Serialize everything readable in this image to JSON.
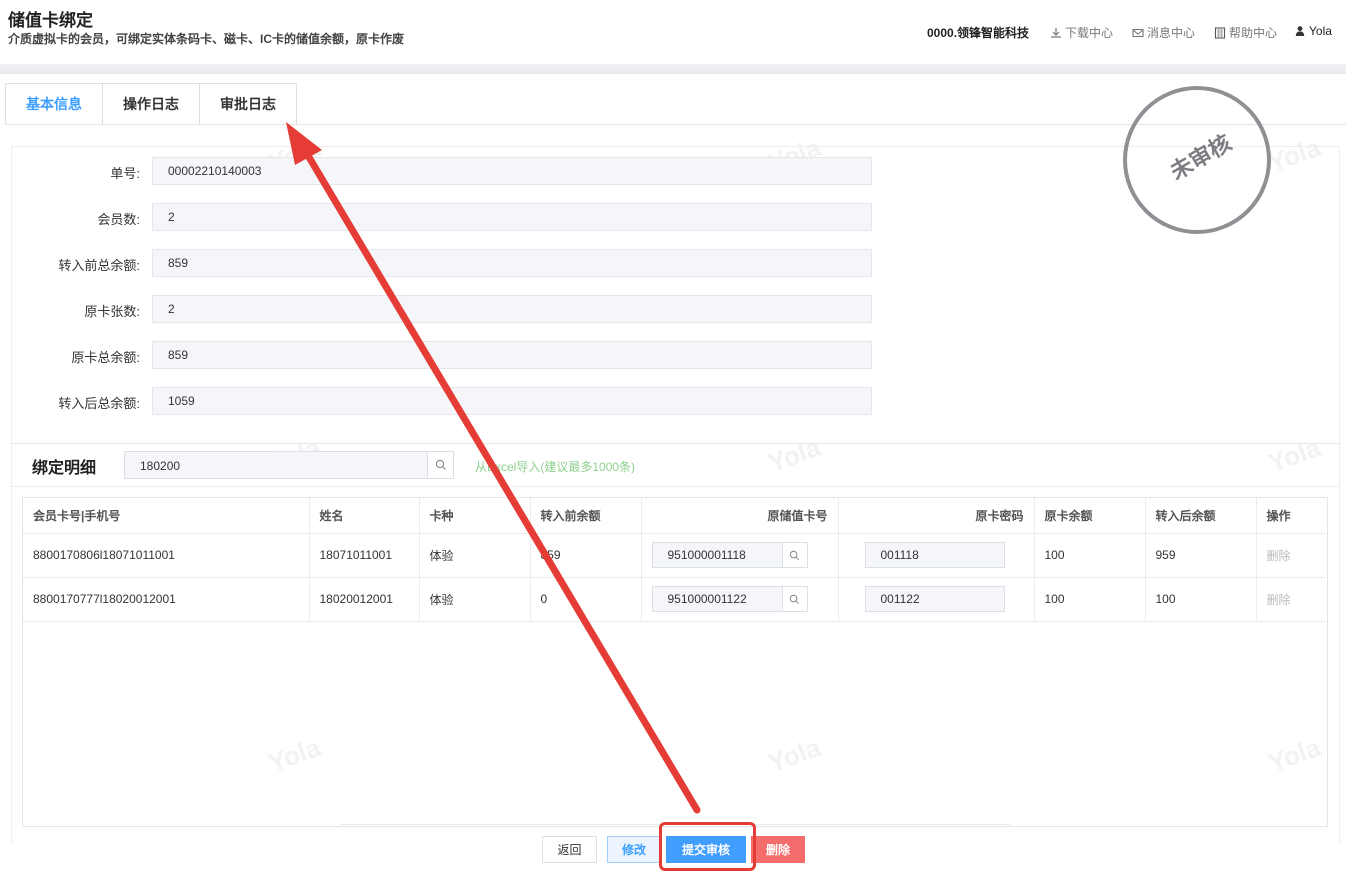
{
  "header": {
    "title": "储值卡绑定",
    "subtitle": "介质虚拟卡的会员，可绑定实体条码卡、磁卡、IC卡的储值余额，原卡作废",
    "company": "0000.领锋智能科技",
    "links": {
      "download": "下载中心",
      "messages": "消息中心",
      "help": "帮助中心",
      "user": "Yola"
    }
  },
  "tabs": [
    "基本信息",
    "操作日志",
    "审批日志"
  ],
  "stamp": "未审核",
  "watermark": "Yola",
  "form": {
    "order_no": {
      "label": "单号:",
      "value": "00002210140003"
    },
    "member_count": {
      "label": "会员数:",
      "value": "2"
    },
    "before_total": {
      "label": "转入前总余额:",
      "value": "859"
    },
    "orig_card_count": {
      "label": "原卡张数:",
      "value": "2"
    },
    "orig_total": {
      "label": "原卡总余额:",
      "value": "859"
    },
    "after_total": {
      "label": "转入后总余额:",
      "value": "1059"
    }
  },
  "bind": {
    "title": "绑定明细",
    "search_value": "180200",
    "excel_import": "从Excel导入(建议最多1000条)"
  },
  "table": {
    "headers": [
      "会员卡号|手机号",
      "姓名",
      "卡种",
      "转入前余额",
      "原储值卡号",
      "原卡密码",
      "原卡余额",
      "转入后余额",
      "操作"
    ],
    "rows": [
      {
        "card": "8800170806l18071011001",
        "name": "18071011001",
        "type": "体验",
        "before": "859",
        "orig_card": "951000001118",
        "pwd": "001118",
        "orig_balance": "100",
        "after": "959",
        "action": "删除"
      },
      {
        "card": "8800170777l18020012001",
        "name": "18020012001",
        "type": "体验",
        "before": "0",
        "orig_card": "951000001122",
        "pwd": "001122",
        "orig_balance": "100",
        "after": "100",
        "action": "删除"
      }
    ]
  },
  "footer": {
    "back": "返回",
    "edit": "修改",
    "submit": "提交审核",
    "delete": "删除"
  },
  "colors": {
    "accent": "#409eff",
    "danger": "#f56c6c",
    "annotation": "#e53c35"
  }
}
